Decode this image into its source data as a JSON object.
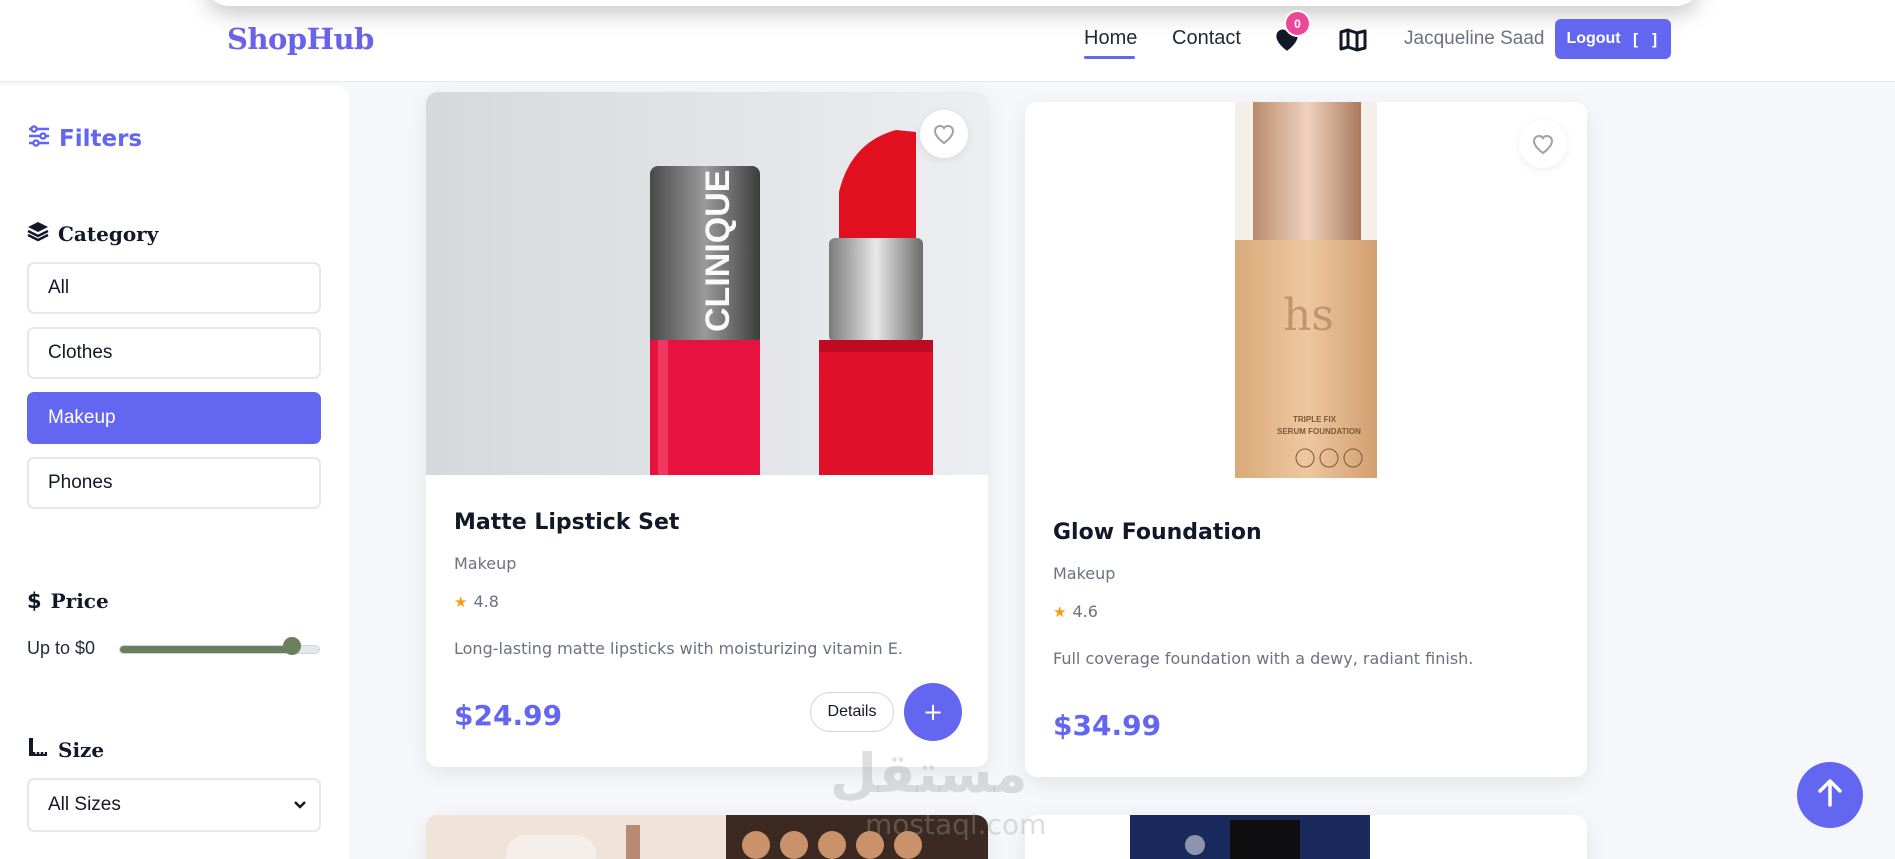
{
  "header": {
    "brand": "ShopHub",
    "nav": {
      "home": "Home",
      "contact": "Contact"
    },
    "wishlist_count": "0",
    "username": "Jacqueline Saad",
    "logout_label": "Logout",
    "logout_icon": "[ ]"
  },
  "sidebar": {
    "filters_title": "Filters",
    "category_title": "Category",
    "categories": [
      "All",
      "Clothes",
      "Makeup",
      "Phones"
    ],
    "active_category": "Makeup",
    "price_title": "Price",
    "price_label": "Up to $0",
    "price_slider_level": 0.86,
    "size_title": "Size",
    "size_selected": "All Sizes"
  },
  "products": [
    {
      "name": "Matte Lipstick Set",
      "category": "Makeup",
      "rating": "4.8",
      "description": "Long-lasting matte lipsticks with moisturizing vitamin E.",
      "price": "$24.99",
      "details_label": "Details",
      "add_label": "+"
    },
    {
      "name": "Glow Foundation",
      "category": "Makeup",
      "rating": "4.6",
      "description": "Full coverage foundation with a dewy, radiant finish.",
      "price": "$34.99"
    }
  ],
  "watermark": {
    "main": "مستقل",
    "sub": "mostaql.com"
  },
  "colors": {
    "accent": "#6366f1",
    "badge": "#ec4899",
    "slider": "#6b7f5f",
    "star": "#f59e0b"
  },
  "icons": [
    "heart-icon",
    "map-icon",
    "logout-icon",
    "sliders-icon",
    "layers-icon",
    "dollar-icon",
    "ruler-icon",
    "arrow-up-icon",
    "chevron-down-icon"
  ]
}
